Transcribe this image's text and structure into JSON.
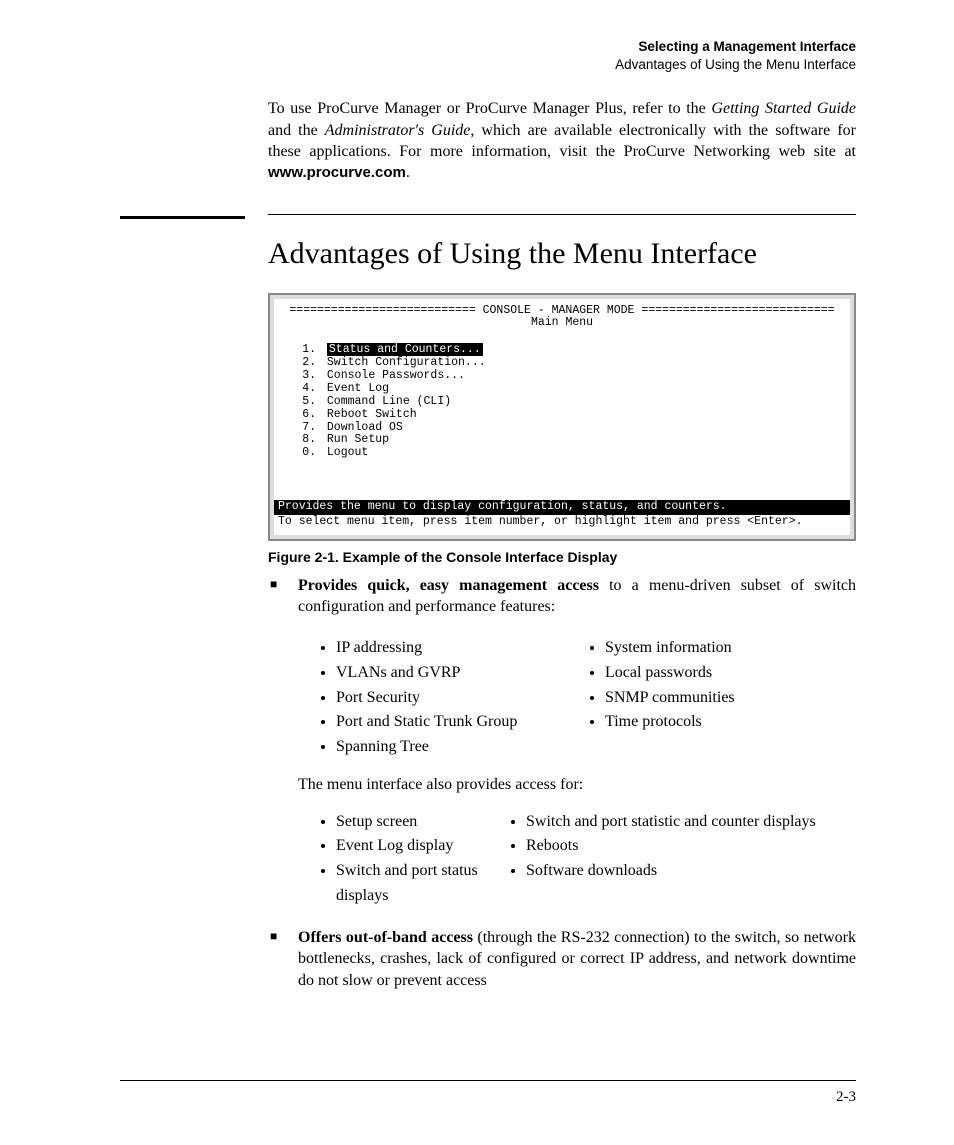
{
  "runningHead": {
    "line1": "Selecting a Management Interface",
    "line2": "Advantages of Using the Menu Interface"
  },
  "intro": {
    "pre": "To use ProCurve Manager or ProCurve Manager Plus, refer to the ",
    "it1": "Getting Started Guide",
    "mid1": " and the ",
    "it2": "Administrator's Guide",
    "mid2": ", which are available electronically with the software for these applications. For more information, visit the ProCurve Networking web site at ",
    "url": "www.procurve.com",
    "post": "."
  },
  "sectionTitle": "Advantages of Using the Menu Interface",
  "console": {
    "titleRule": "=========================== CONSOLE - MANAGER MODE ============================",
    "subtitle": "Main Menu",
    "items": [
      {
        "n": "1.",
        "label": "Status and Counters...",
        "selected": true
      },
      {
        "n": "2.",
        "label": "Switch Configuration...",
        "selected": false
      },
      {
        "n": "3.",
        "label": "Console Passwords...",
        "selected": false
      },
      {
        "n": "4.",
        "label": "Event Log",
        "selected": false
      },
      {
        "n": "5.",
        "label": "Command Line (CLI)",
        "selected": false
      },
      {
        "n": "6.",
        "label": "Reboot Switch",
        "selected": false
      },
      {
        "n": "7.",
        "label": "Download OS",
        "selected": false
      },
      {
        "n": "8.",
        "label": "Run Setup",
        "selected": false
      },
      {
        "n": "0.",
        "label": "Logout",
        "selected": false
      }
    ],
    "status": "Provides the menu to display configuration, status, and counters.",
    "help": "To select menu item, press item number, or highlight item and press <Enter>."
  },
  "figCaption": "Figure 2-1.   Example of the Console Interface Display",
  "bullet1": {
    "lead": "Provides quick, easy management access",
    "rest": " to a menu-driven subset of switch configuration and performance features:"
  },
  "featuresLeft": [
    "IP addressing",
    "VLANs and GVRP",
    "Port Security",
    "Port and Static Trunk Group",
    "Spanning Tree"
  ],
  "featuresRight": [
    "System information",
    "Local passwords",
    "SNMP communities",
    "Time protocols"
  ],
  "alsoProvides": "The menu interface also provides access for:",
  "accessLeft": [
    "Setup screen",
    "Event Log display",
    "Switch and port status displays"
  ],
  "accessRight": [
    "Switch and port statistic and counter displays",
    "Reboots",
    "Software downloads"
  ],
  "bullet2": {
    "lead": "Offers out-of-band access",
    "rest": " (through the RS-232 connection) to the switch, so network bottlenecks, crashes, lack of configured or correct IP address, and network downtime do not slow or prevent access"
  },
  "pageNumber": "2-3"
}
